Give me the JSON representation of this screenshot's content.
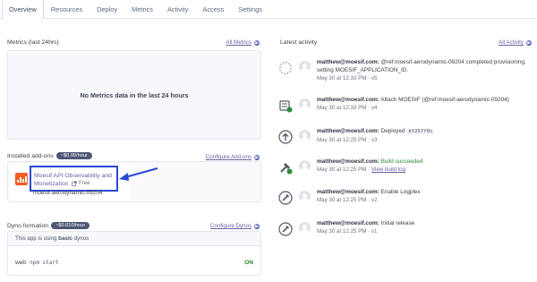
{
  "tabs": [
    {
      "label": "Overview",
      "active": true
    },
    {
      "label": "Resources",
      "active": false
    },
    {
      "label": "Deploy",
      "active": false
    },
    {
      "label": "Metrics",
      "active": false
    },
    {
      "label": "Activity",
      "active": false
    },
    {
      "label": "Access",
      "active": false
    },
    {
      "label": "Settings",
      "active": false
    }
  ],
  "metrics": {
    "title": "Metrics (last 24hrs)",
    "link": "All Metrics",
    "empty_message": "No Metrics data in the last 24 hours"
  },
  "addons": {
    "title": "Installed add-ons",
    "cost": "~$0.00/hour",
    "link": "Configure Add-ons",
    "item": {
      "name": "Moesif API Observability and Monetization",
      "plan": "Free",
      "app": "moesif-aerodynamic-09204",
      "logo_color": "#f15c22"
    }
  },
  "dynos": {
    "title": "Dyno formation",
    "cost": "~$0.010/hour",
    "link": "Configure Dynos",
    "note_prefix": "This app is using",
    "note_bold": "basic",
    "note_suffix": "dynos",
    "process": "web",
    "command": "npm start",
    "state": "ON"
  },
  "activity": {
    "title": "Latest activity",
    "link": "All Activity",
    "items": [
      {
        "icon": "config-var-icon",
        "user": "matthew@moesif.com:",
        "text": "@ref:moesif-aerodynamic-09204 completed provisioning, setting MOESIF_APPLICATION_ID.",
        "meta": "May 30 at 12:33 PM · v5"
      },
      {
        "icon": "addon-attach-icon",
        "user": "matthew@moesif.com:",
        "text": "Attach MOESIF (@ref:moesif-aerodynamic-09204)",
        "meta": "May 30 at 12:33 PM · v4"
      },
      {
        "icon": "deploy-icon",
        "user": "matthew@moesif.com:",
        "text": "Deployed",
        "hash": "bf257f0c",
        "meta": "May 30 at 12:25 PM · v3"
      },
      {
        "icon": "build-icon",
        "user": "matthew@moesif.com:",
        "status": "Build succeeded",
        "meta": "May 30 at 12:25 PM ·",
        "meta_link": "View build log"
      },
      {
        "icon": "logplex-icon",
        "user": "matthew@moesif.com:",
        "text": "Enable Logplex",
        "meta": "May 30 at 12:25 PM · v2"
      },
      {
        "icon": "release-icon",
        "user": "matthew@moesif.com:",
        "text": "Initial release",
        "meta": "May 30 at 12:25 PM · v1"
      }
    ]
  }
}
